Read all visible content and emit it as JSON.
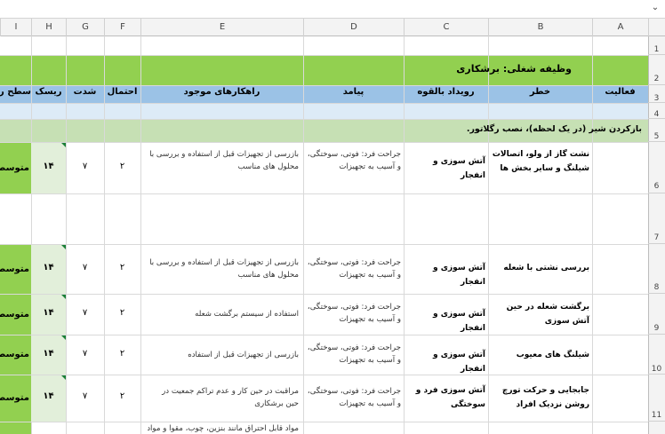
{
  "columns": [
    "I",
    "H",
    "G",
    "F",
    "E",
    "D",
    "C",
    "B",
    "A"
  ],
  "rows": [
    "1",
    "2",
    "3",
    "4",
    "5",
    "6",
    "7",
    "8",
    "9",
    "10",
    "11"
  ],
  "title": "وظیفه شغلی:  برشکاری",
  "headers": {
    "activity": "فعالیت",
    "hazard": "خطر",
    "potential_event": "رویداد بالقوه",
    "consequence": "پیامد",
    "existing_measures": "راهکارهای موجود",
    "probability": "احتمال",
    "severity": "شدت",
    "risk": "ریسک",
    "risk_level": "سطح ریس"
  },
  "section": "بازکردن شیر (در یک لحظه)، نصب رگلاتور.",
  "table_rows": [
    {
      "hazard": "نشت گاز از ولو، اتصالات شیلنگ و سایر بخش ها",
      "event": "آتش سوزی و انفجار",
      "consequence": "جراحت فرد: فوتی، سوختگی، و آسیب به تجهیزات",
      "measures": "بازرسی از تجهیزات قبل از استفاده و بررسی با محلول های مناسب",
      "probability": "۲",
      "severity": "۷",
      "risk": "۱۴",
      "level": "متوسط"
    },
    {
      "hazard": "بررسی نشتی با شعله",
      "event": "آتش سوزی و انفجار",
      "consequence": "جراحت فرد: فوتی، سوختگی، و آسیب به تجهیزات",
      "measures": "بازرسی از تجهیزات قبل از استفاده و بررسی با محلول های مناسب",
      "probability": "۲",
      "severity": "۷",
      "risk": "۱۴",
      "level": "متوسط"
    },
    {
      "hazard": "برگشت شعله در حین آتش سوزی",
      "event": "آتش سوزی و انفجار",
      "consequence": "جراحت فرد: فوتی، سوختگی، و آسیب به تجهیزات",
      "measures": "استفاده از سیستم برگشت شعله",
      "probability": "۲",
      "severity": "۷",
      "risk": "۱۴",
      "level": "متوسط"
    },
    {
      "hazard": "شیلنگ های معیوب",
      "event": "آتش سوزی و انفجار",
      "consequence": "جراحت فرد: فوتی، سوختگی، و آسیب به تجهیزات",
      "measures": "بازرسی از تجهیزات قبل از استفاده",
      "probability": "۲",
      "severity": "۷",
      "risk": "۱۴",
      "level": "متوسط"
    },
    {
      "hazard": "جابجایی و حرکت تورچ روشن نزدیک افراد",
      "event": "آتش سوزی فرد و سوختگی",
      "consequence": "جراحت فرد: فوتی، سوختگی، و آسیب به تجهیزات",
      "measures": "مراقبت در حین کار و عدم تراکم جمعیت در حین برشکاری",
      "probability": "۲",
      "severity": "۷",
      "risk": "۱۴",
      "level": "متوسط"
    }
  ],
  "partial_row": {
    "measures": "مواد قابل احتراق مانند بنزین، چوب، مقوا و مواد"
  },
  "colors": {
    "title_band": "#92d050",
    "header_band": "#9bc2e6",
    "section_band": "#c6e0b4",
    "risk_cell": "#92d050"
  },
  "icons": {
    "formula_expand": "chevron-down-icon",
    "comment_marker": "comment-indicator-icon"
  }
}
